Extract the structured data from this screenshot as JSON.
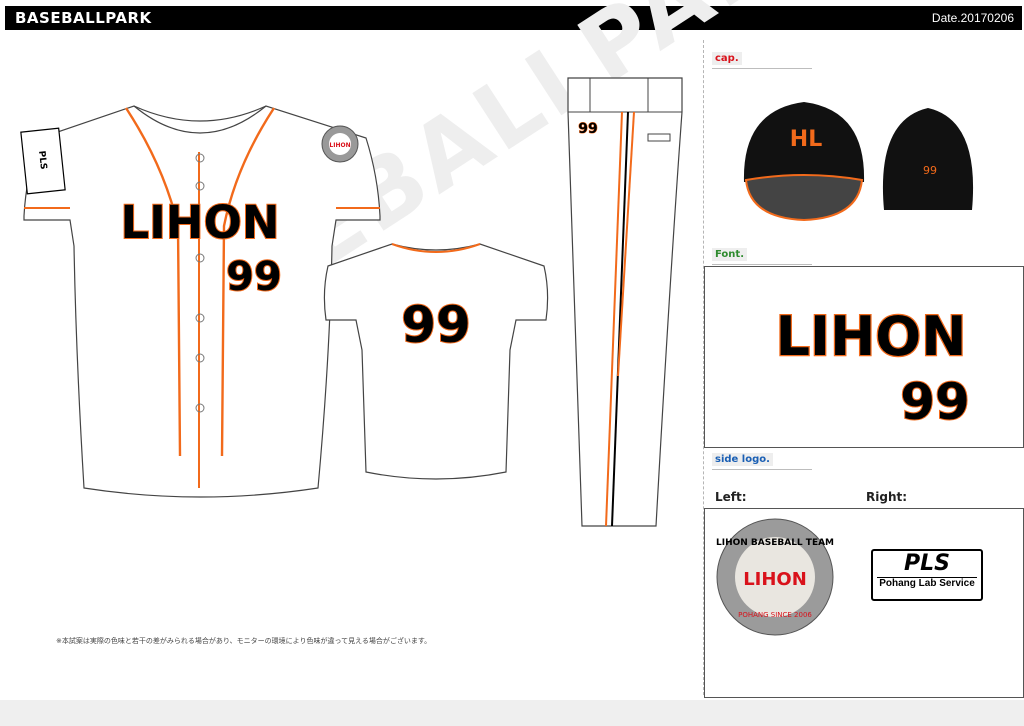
{
  "header": {
    "brand": "BASEBALLPARK",
    "date": "Date.20170206"
  },
  "watermark": "BASEBALLPARK",
  "jersey_front": {
    "team": "LIHON",
    "number": "99",
    "sleeve_patch": "PLS",
    "sleeve_patch_sub": "Pohang Lab Service"
  },
  "jersey_back": {
    "number": "99"
  },
  "pants": {
    "number": "99"
  },
  "sections": {
    "cap": {
      "title": "cap.",
      "back_number": "99",
      "logo": "HL"
    },
    "font": {
      "title": "Font.",
      "team": "LIHON",
      "number": "99"
    },
    "side_logo": {
      "title": "side logo.",
      "left_label": "Left:",
      "right_label": "Right:"
    }
  },
  "left_logo": {
    "top_text": "LIHON BASEBALL TEAM",
    "center": "LIHON",
    "bottom_text": "POHANG SINCE 2006"
  },
  "right_logo": {
    "main": "PLS",
    "sub": "Pohang Lab Service"
  },
  "note": "※本試案は実際の色味と若干の差がみられる場合があり、モニターの環境により色味が違って見える場合がございます。",
  "colors": {
    "accent_orange": "#f26a1b",
    "black": "#000000",
    "logo_red": "#d9121b"
  }
}
